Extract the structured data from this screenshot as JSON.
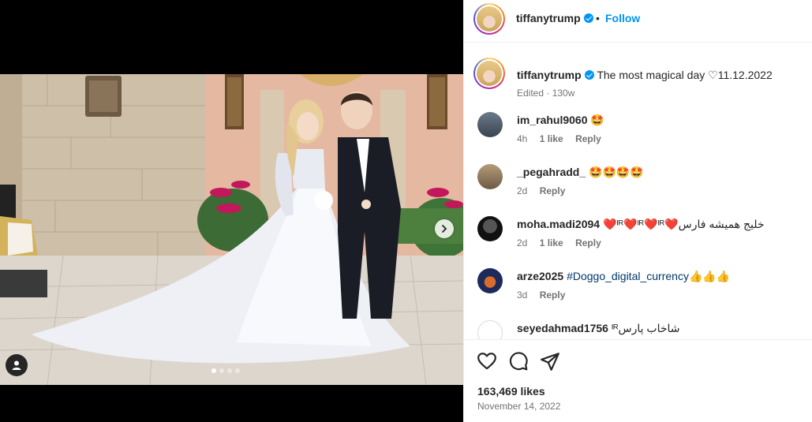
{
  "post": {
    "author": "tiffanytrump",
    "follow_label": "Follow",
    "separator": "•",
    "caption": "The most magical day ♡11.12.2022",
    "caption_meta": "Edited · 130w",
    "likes": "163,469 likes",
    "date": "November 14, 2022",
    "carousel": {
      "total": 4,
      "active": 1
    }
  },
  "comments": [
    {
      "user": "im_rahul9060",
      "text": "🤩",
      "time": "4h",
      "likes": "1 like",
      "reply": "Reply"
    },
    {
      "user": "_pegahradd_",
      "text": "🤩🤩🤩🤩",
      "time": "2d",
      "likes": "",
      "reply": "Reply"
    },
    {
      "user": "moha.madi2094",
      "text": "❤️ᴵᴿ❤️ᴵᴿ❤️ᴵᴿ❤️خلیج همیشه فارس",
      "time": "2d",
      "likes": "1 like",
      "reply": "Reply"
    },
    {
      "user": "arze2025",
      "hashtag": "#Doggo_digital_currency",
      "text": "👍👍👍",
      "time": "3d",
      "likes": "",
      "reply": "Reply"
    },
    {
      "user": "seyedahmad1756",
      "text": "ᴵᴿشاخاب پارس",
      "time": "",
      "likes": "",
      "reply": ""
    }
  ],
  "icons": {
    "like": "heart-icon",
    "comment": "comment-icon",
    "share": "share-icon",
    "next": "chevron-right-icon",
    "tags": "user-tag-icon"
  },
  "colors": {
    "accent": "#0095f6",
    "muted": "#737373",
    "text": "#262626",
    "hashtag": "#00376b"
  }
}
